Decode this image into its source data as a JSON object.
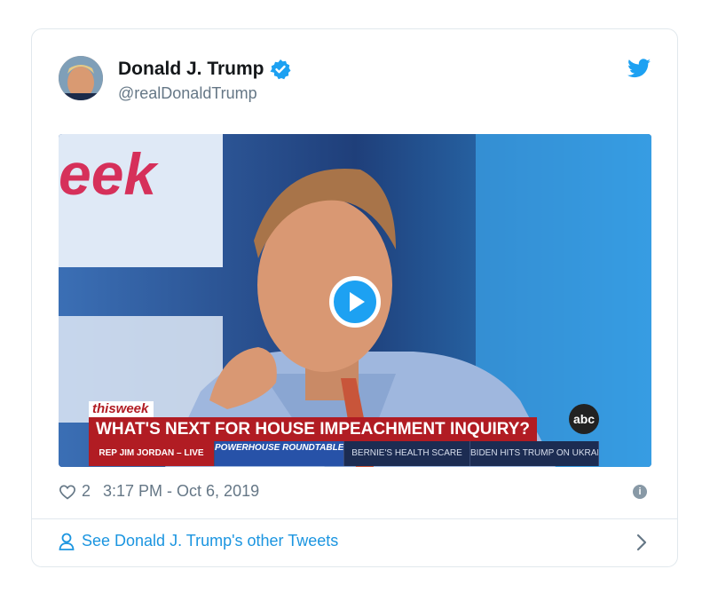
{
  "tweet": {
    "author_name": "Donald J. Trump",
    "handle": "@realDonaldTrump",
    "likes": "2",
    "timestamp": "3:17 PM - Oct 6, 2019",
    "footer_link": "See Donald J. Trump's other Tweets"
  },
  "video": {
    "show_tag": "thisweek",
    "headline": "WHAT'S NEXT FOR HOUSE IMPEACHMENT INQUIRY?",
    "ticker": [
      "REP JIM JORDAN – LIVE",
      "POWERHOUSE ROUNDTABLE",
      "BERNIE'S HEALTH SCARE",
      "BIDEN HITS TRUMP ON UKRAINE"
    ],
    "network_logo": "abc",
    "bg_word": "eek"
  },
  "colors": {
    "accent": "#1da1f2",
    "link": "#1b95e0",
    "muted": "#657786",
    "chyron_red": "#b11c23"
  },
  "icons": [
    "verified-badge-icon",
    "twitter-bird-icon",
    "play-icon",
    "heart-icon",
    "info-icon",
    "user-icon",
    "chevron-right-icon"
  ]
}
